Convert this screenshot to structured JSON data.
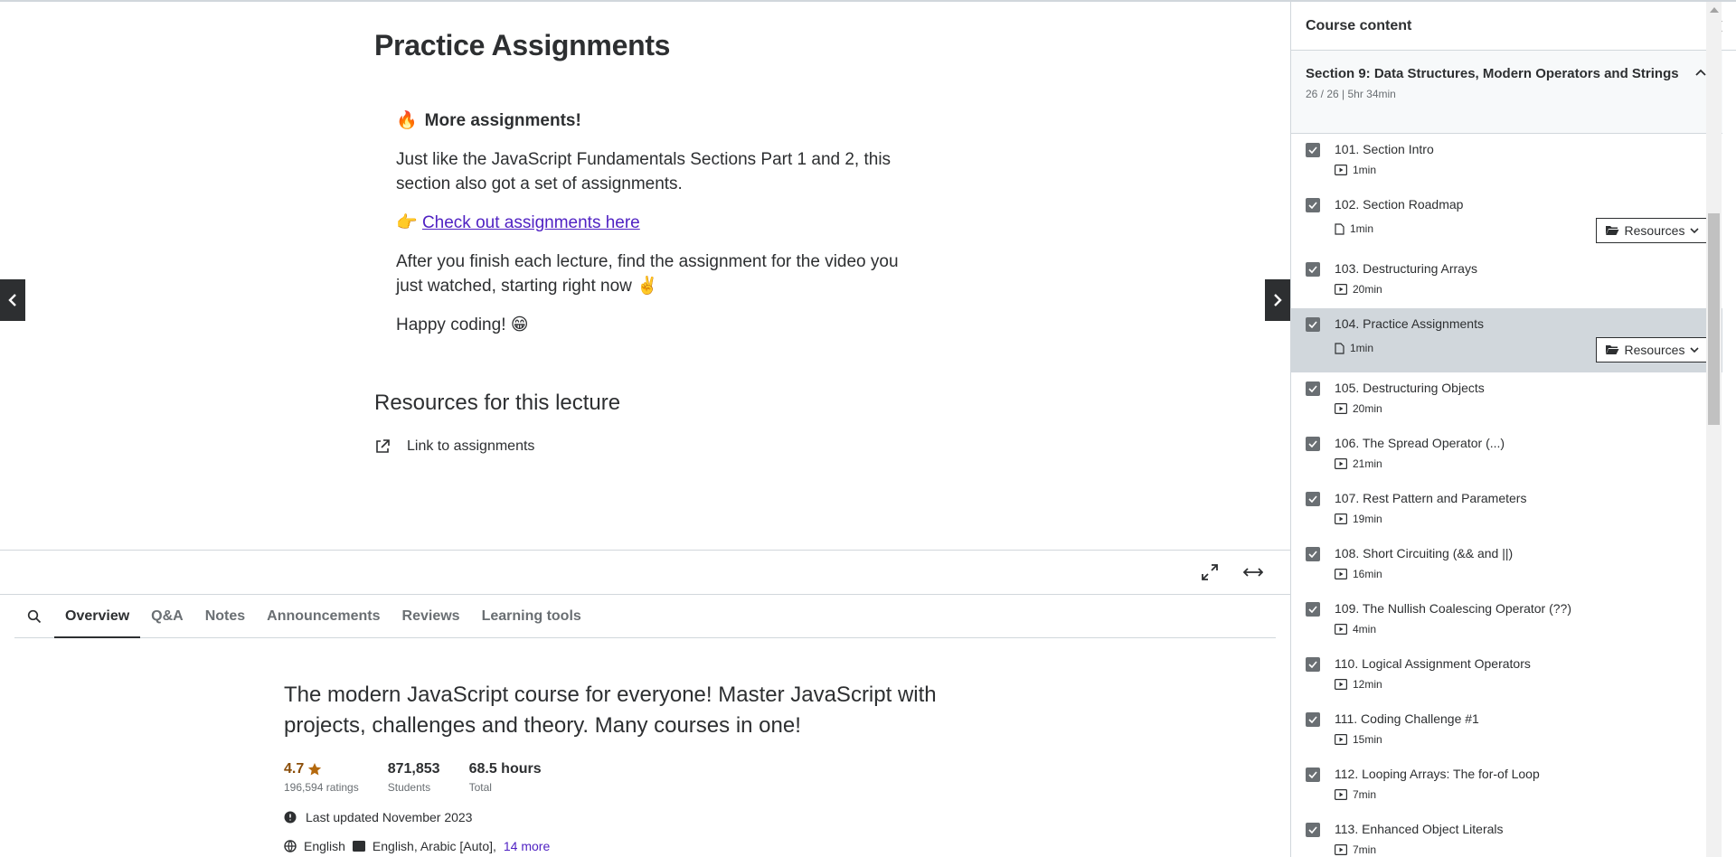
{
  "lecture": {
    "title": "Practice Assignments",
    "article_heading": "More assignments!",
    "fire_emoji": "🔥",
    "para1": "Just like the JavaScript Fundamentals Sections Part 1 and 2, this section also got a set of assignments.",
    "point_emoji": "👉",
    "link_text": "Check out assignments here",
    "para2": "After you finish each lecture, find the assignment for the video you just watched, starting right now ✌️",
    "para3": "Happy coding! 😁",
    "resources_title": "Resources for this lecture",
    "resource_link": "Link to assignments"
  },
  "tabs": [
    {
      "label": "Overview"
    },
    {
      "label": "Q&A"
    },
    {
      "label": "Notes"
    },
    {
      "label": "Announcements"
    },
    {
      "label": "Reviews"
    },
    {
      "label": "Learning tools"
    }
  ],
  "overview": {
    "headline": "The modern JavaScript course for everyone! Master JavaScript with projects, challenges and theory. Many courses in one!",
    "rating": "4.7",
    "ratings_count": "196,594 ratings",
    "students": "871,853",
    "students_label": "Students",
    "hours": "68.5 hours",
    "hours_label": "Total",
    "updated": "Last updated November 2023",
    "language": "English",
    "captions": "English, Arabic [Auto],",
    "more": "14 more"
  },
  "sidebar": {
    "title": "Course content",
    "section": {
      "title": "Section 9: Data Structures, Modern Operators and Strings",
      "meta": "26 / 26 | 5hr 34min"
    },
    "resources_label": "Resources",
    "lessons": [
      {
        "title": "101. Section Intro",
        "duration": "1min",
        "kind": "video"
      },
      {
        "title": "102. Section Roadmap",
        "duration": "1min",
        "kind": "doc"
      },
      {
        "title": "103. Destructuring Arrays",
        "duration": "20min",
        "kind": "video"
      },
      {
        "title": "104. Practice Assignments",
        "duration": "1min",
        "kind": "doc"
      },
      {
        "title": "105. Destructuring Objects",
        "duration": "20min",
        "kind": "video"
      },
      {
        "title": "106. The Spread Operator (...)",
        "duration": "21min",
        "kind": "video"
      },
      {
        "title": "107. Rest Pattern and Parameters",
        "duration": "19min",
        "kind": "video"
      },
      {
        "title": "108. Short Circuiting (&& and ||)",
        "duration": "16min",
        "kind": "video"
      },
      {
        "title": "109. The Nullish Coalescing Operator (??)",
        "duration": "4min",
        "kind": "video"
      },
      {
        "title": "110. Logical Assignment Operators",
        "duration": "12min",
        "kind": "video"
      },
      {
        "title": "111. Coding Challenge #1",
        "duration": "15min",
        "kind": "video"
      },
      {
        "title": "112. Looping Arrays: The for-of Loop",
        "duration": "7min",
        "kind": "video"
      },
      {
        "title": "113. Enhanced Object Literals",
        "duration": "7min",
        "kind": "video"
      }
    ]
  }
}
